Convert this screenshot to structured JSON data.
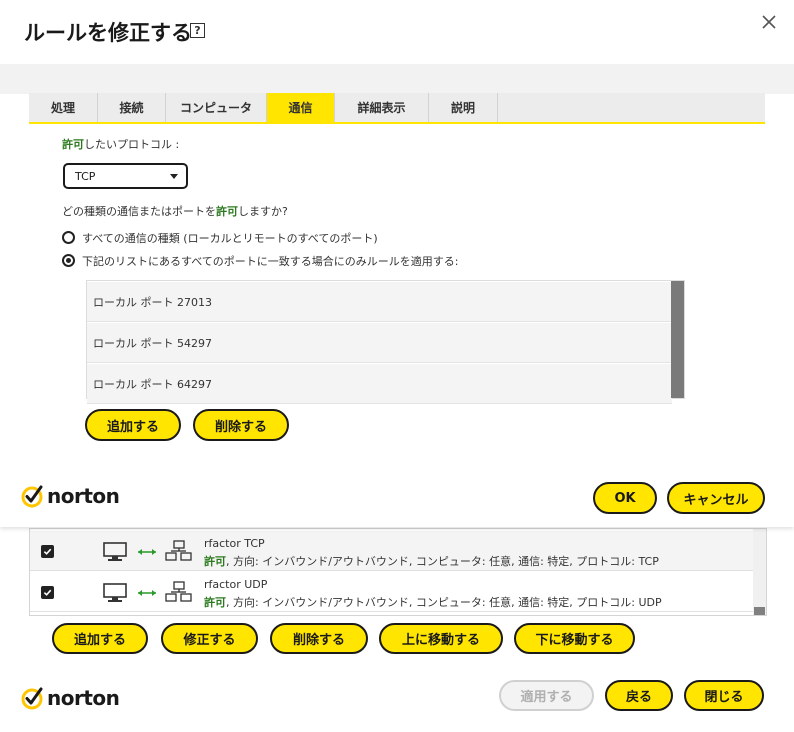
{
  "background_window": {
    "rules": [
      {
        "checked": true,
        "name": "rfactor TCP",
        "allow": "許可",
        "description": ", 方向: インバウンド/アウトバウンド, コンピュータ: 任意, 通信: 特定, プロトコル: TCP"
      },
      {
        "checked": true,
        "name": "rfactor UDP",
        "allow": "許可",
        "description": ", 方向: インバウンド/アウトバウンド, コンピュータ: 任意, 通信: 特定, プロトコル: UDP"
      }
    ],
    "buttons": {
      "add": "追加する",
      "modify": "修正する",
      "delete": "削除する",
      "move_up": "上に移動する",
      "move_down": "下に移動する"
    },
    "footer": {
      "logo": "norton",
      "apply": "適用する",
      "back": "戻る",
      "close": "閉じる"
    }
  },
  "dialog": {
    "title": "ルールを修正する",
    "help_glyph": "?",
    "tabs": [
      {
        "label": "処理"
      },
      {
        "label": "接続"
      },
      {
        "label": "コンピュータ"
      },
      {
        "label": "通信"
      },
      {
        "label": "詳細表示"
      },
      {
        "label": "説明"
      }
    ],
    "active_tab": "通信",
    "protocol_label_green": "許可",
    "protocol_label_rest": "したいプロトコル :",
    "protocol_value": "TCP",
    "question_prefix": "どの種類の通信またはポートを",
    "question_green": "許可",
    "question_suffix": "しますか?",
    "radio_all": "すべての通信の種類 (ローカルとリモートのすべてのポート)",
    "radio_list": "下記のリストにあるすべてのポートに一致する場合にのみルールを適用する:",
    "selected_radio": "list",
    "ports": [
      "ローカル ポート 27013",
      "ローカル ポート 54297",
      "ローカル ポート 64297"
    ],
    "add_button": "追加する",
    "delete_button": "削除する",
    "footer": {
      "logo": "norton",
      "ok": "OK",
      "cancel": "キャンセル"
    }
  },
  "colors": {
    "accent": "#ffe500",
    "allow_green": "#2a7a1d",
    "logo_ring": "#ffc600"
  },
  "icons": [
    "close-icon",
    "help-icon",
    "checkmark-icon",
    "computer-icon",
    "bidirectional-arrow-icon",
    "network-icon",
    "norton-checkmark-icon",
    "dropdown-caret-icon"
  ]
}
